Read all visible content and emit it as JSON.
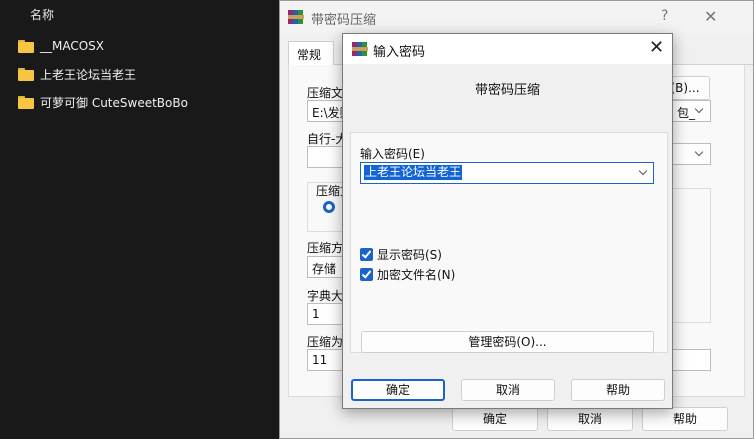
{
  "explorer": {
    "column_header": "名称",
    "folders": [
      "__MACOSX",
      "上老王论坛当老王",
      "可萝可御 CuteSweetBoBo"
    ]
  },
  "back_dialog": {
    "title": "带密码压缩",
    "help": "?",
    "close": "✕",
    "tab_general": "常规",
    "archive_label": "压缩文",
    "archive_path": "E:\\发财",
    "browse_button": "(B)...",
    "profile_value": "包_",
    "auto_label": "自行-大",
    "format_group": "压缩文",
    "method_label": "压缩方",
    "method_value": "存储",
    "dict_label": "字典大",
    "dict_value": "1",
    "split_label": "压缩为",
    "split_value": "11",
    "ok_button": "确定",
    "cancel_button": "取消",
    "help_button": "帮助"
  },
  "front_dialog": {
    "title": "输入密码",
    "close": "✕",
    "subtitle": "带密码压缩",
    "password_label": "输入密码(E)",
    "password_value": "上老王论坛当老王",
    "show_password_label": "显示密码(S)",
    "encrypt_names_label": "加密文件名(N)",
    "manage_button": "管理密码(O)...",
    "ok_button": "确定",
    "cancel_button": "取消",
    "help_button": "帮助"
  },
  "colors": {
    "accent": "#1a63c8",
    "selection": "#1264d6",
    "explorer_bg": "#191919",
    "folder": "#f6c544"
  },
  "icons": [
    "folder-icon",
    "winrar-icon",
    "chevron-down-icon",
    "close-icon",
    "help-icon",
    "checkbox-checked-icon",
    "radio-selected-icon"
  ]
}
